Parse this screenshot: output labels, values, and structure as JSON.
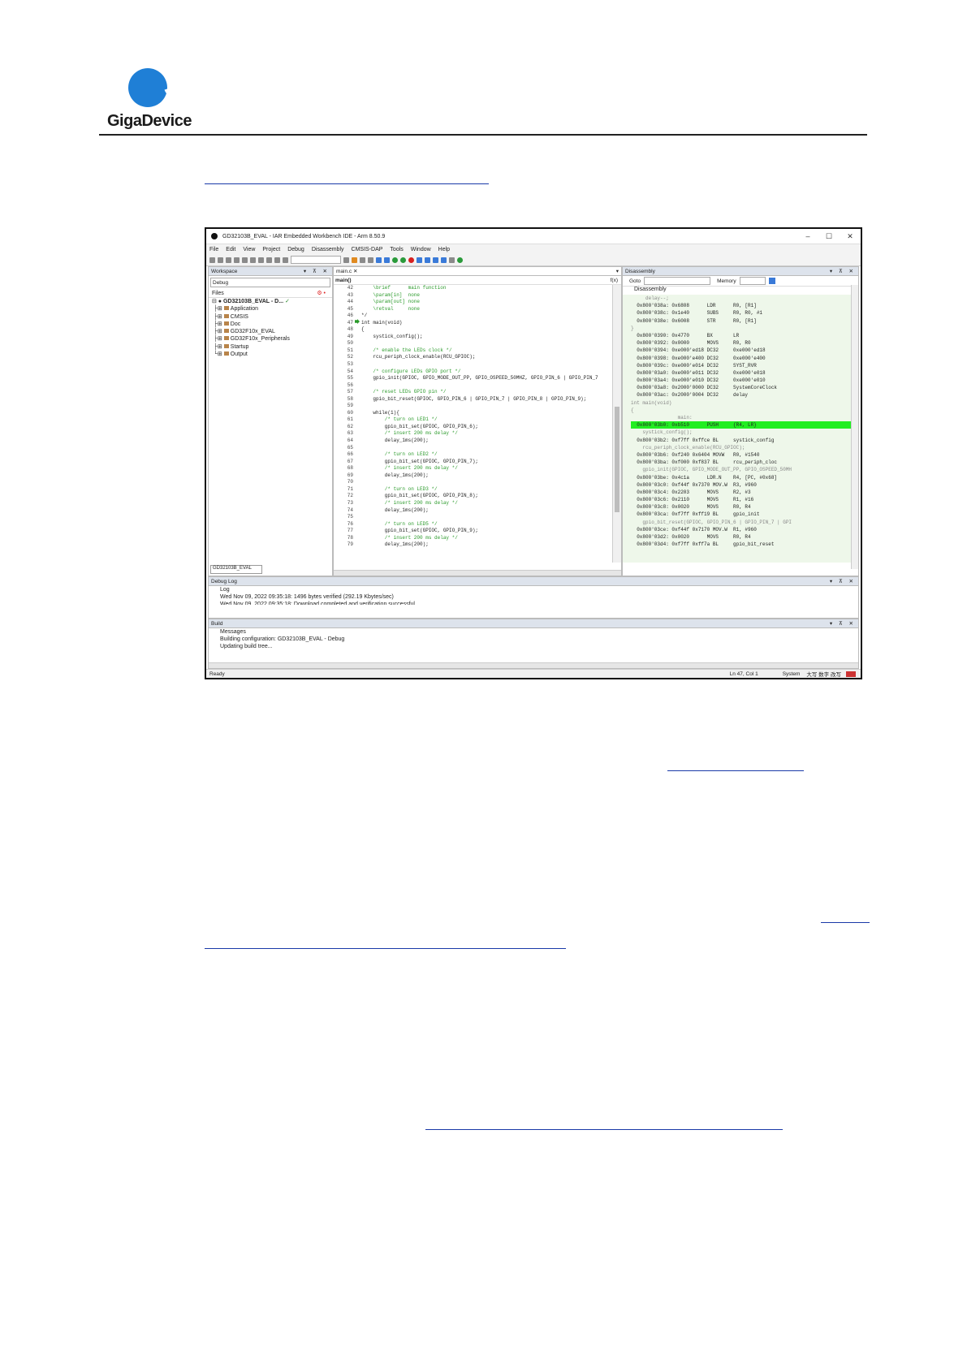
{
  "logo": {
    "text": "GigaDevice"
  },
  "ide": {
    "title": "GD32103B_EVAL - IAR Embedded Workbench IDE - Arm 8.50.9",
    "window_buttons": [
      "–",
      "☐",
      "✕"
    ],
    "menu": [
      "File",
      "Edit",
      "View",
      "Project",
      "Debug",
      "Disassembly",
      "CMSIS-DAP",
      "Tools",
      "Window",
      "Help"
    ],
    "workspace": {
      "title": "Workspace",
      "config": "Debug",
      "files_label": "Files",
      "root": "GD32103B_EVAL - D...",
      "folders": [
        "Application",
        "CMSIS",
        "Doc",
        "GD32F10x_EVAL",
        "GD32F10x_Peripherals",
        "Startup",
        "Output"
      ],
      "tab": "GD32103B_EVAL"
    },
    "editor": {
      "tab": "main.c",
      "func": "main()",
      "fx": "f(x)",
      "line_numbers": [
        "42",
        "43",
        "44",
        "45",
        "46",
        "47",
        "48",
        "49",
        "50",
        "51",
        "52",
        "53",
        "54",
        "55",
        "56",
        "57",
        "58",
        "59",
        "60",
        "61",
        "62",
        "63",
        "64",
        "65",
        "66",
        "67",
        "68",
        "69",
        "70",
        "71",
        "72",
        "73",
        "74",
        "75",
        "76",
        "77",
        "78",
        "79"
      ],
      "lines": [
        "    \\brief      main function",
        "    \\param[in]  none",
        "    \\param[out] none",
        "    \\retval     none",
        "*/",
        "int main(void)",
        "{",
        "    systick_config();",
        "",
        "    /* enable the LEDs clock */",
        "    rcu_periph_clock_enable(RCU_GPIOC);",
        "",
        "    /* configure LEDs GPIO port */",
        "    gpio_init(GPIOC, GPIO_MODE_OUT_PP, GPIO_OSPEED_50MHZ, GPIO_PIN_6 | GPIO_PIN_7",
        "",
        "    /* reset LEDs GPIO pin */",
        "    gpio_bit_reset(GPIOC, GPIO_PIN_6 | GPIO_PIN_7 | GPIO_PIN_8 | GPIO_PIN_9);",
        "",
        "    while(1){",
        "        /* turn on LED1 */",
        "        gpio_bit_set(GPIOC, GPIO_PIN_6);",
        "        /* insert 200 ms delay */",
        "        delay_1ms(200);",
        "",
        "        /* turn on LED2 */",
        "        gpio_bit_set(GPIOC, GPIO_PIN_7);",
        "        /* insert 200 ms delay */",
        "        delay_1ms(200);",
        "",
        "        /* turn on LED3 */",
        "        gpio_bit_set(GPIOC, GPIO_PIN_8);",
        "        /* insert 200 ms delay */",
        "        delay_1ms(200);",
        "",
        "        /* turn on LED5 */",
        "        gpio_bit_set(GPIOC, GPIO_PIN_9);",
        "        /* insert 200 ms delay */",
        "        delay_1ms(200);"
      ]
    },
    "disassembly": {
      "title": "Disassembly",
      "goto_label": "Goto",
      "memory_label": "Memory",
      "header": "Disassembly",
      "rows": [
        "     delay--;",
        "  0x800'038a: 0x6808      LDR      R0, [R1]",
        "  0x800'038c: 0x1e40      SUBS     R0, R0, #1",
        "  0x800'038e: 0x6008      STR      R0, [R1]",
        "}",
        "  0x800'0390: 0x4770      BX       LR",
        "  0x800'0392: 0x0000      MOVS     R0, R0",
        "  0x800'0394: 0xe000'ed18 DC32     0xe000'ed18",
        "  0x800'0398: 0xe000'e400 DC32     0xe000'e400",
        "  0x800'039c: 0xe000'e014 DC32     SYST_RVR",
        "  0x800'03a0: 0xe000'e011 DC32     0xe000'e018",
        "  0x800'03a4: 0xe000'e010 DC32     0xe000'e010",
        "  0x800'03a8: 0x2000'0000 DC32     SystemCoreClock",
        "  0x800'03ac: 0x2000'0004 DC32     delay",
        "int main(void)",
        "{",
        "                main:",
        "  0x800'03b0: 0xb510      PUSH     {R4, LR}",
        "    systick_config();",
        "  0x800'03b2: 0xf7ff 0xffce BL     systick_config",
        "    rcu_periph_clock_enable(RCU_GPIOC);",
        "  0x800'03b6: 0xf240 0x6404 MOVW   R0, #1540",
        "  0x800'03ba: 0xf000 0xf837 BL     rcu_periph_cloc",
        "    gpio_init(GPIOC, GPIO_MODE_OUT_PP, GPIO_OSPEED_50MH",
        "  0x800'03be: 0x4c1a      LDR.N    R4, [PC, #0x68]",
        "  0x800'03c0: 0xf44f 0x7370 MOV.W  R3, #960",
        "  0x800'03c4: 0x2203      MOVS     R2, #3",
        "  0x800'03c6: 0x2110      MOVS     R1, #16",
        "  0x800'03c8: 0x0020      MOVS     R0, R4",
        "  0x800'03ca: 0xf7ff 0xff19 BL     gpio_init",
        "    gpio_bit_reset(GPIOC, GPIO_PIN_6 | GPIO_PIN_7 | GPI",
        "  0x800'03ce: 0xf44f 0x7170 MOV.W  R1, #960",
        "  0x800'03d2: 0x0020      MOVS     R0, R4",
        "  0x800'03d4: 0xf7ff 0xff7a BL     gpio_bit_reset"
      ]
    },
    "debug_log": {
      "title": "Debug Log",
      "header": "Log",
      "lines": [
        "Wed Nov 09, 2022 09:35:18: 1496 bytes verified (292.19 Kbytes/sec)",
        "Wed Nov 09, 2022 09:35:18: Download completed and verification successful."
      ]
    },
    "build": {
      "title": "Build",
      "header": "Messages",
      "lines": [
        "Building configuration: GD32103B_EVAL - Debug",
        "Updating build tree..."
      ]
    },
    "status": {
      "left": "Ready",
      "position": "Ln 47, Col 1",
      "mode": "System",
      "ime": "大写  数字  改写"
    }
  }
}
